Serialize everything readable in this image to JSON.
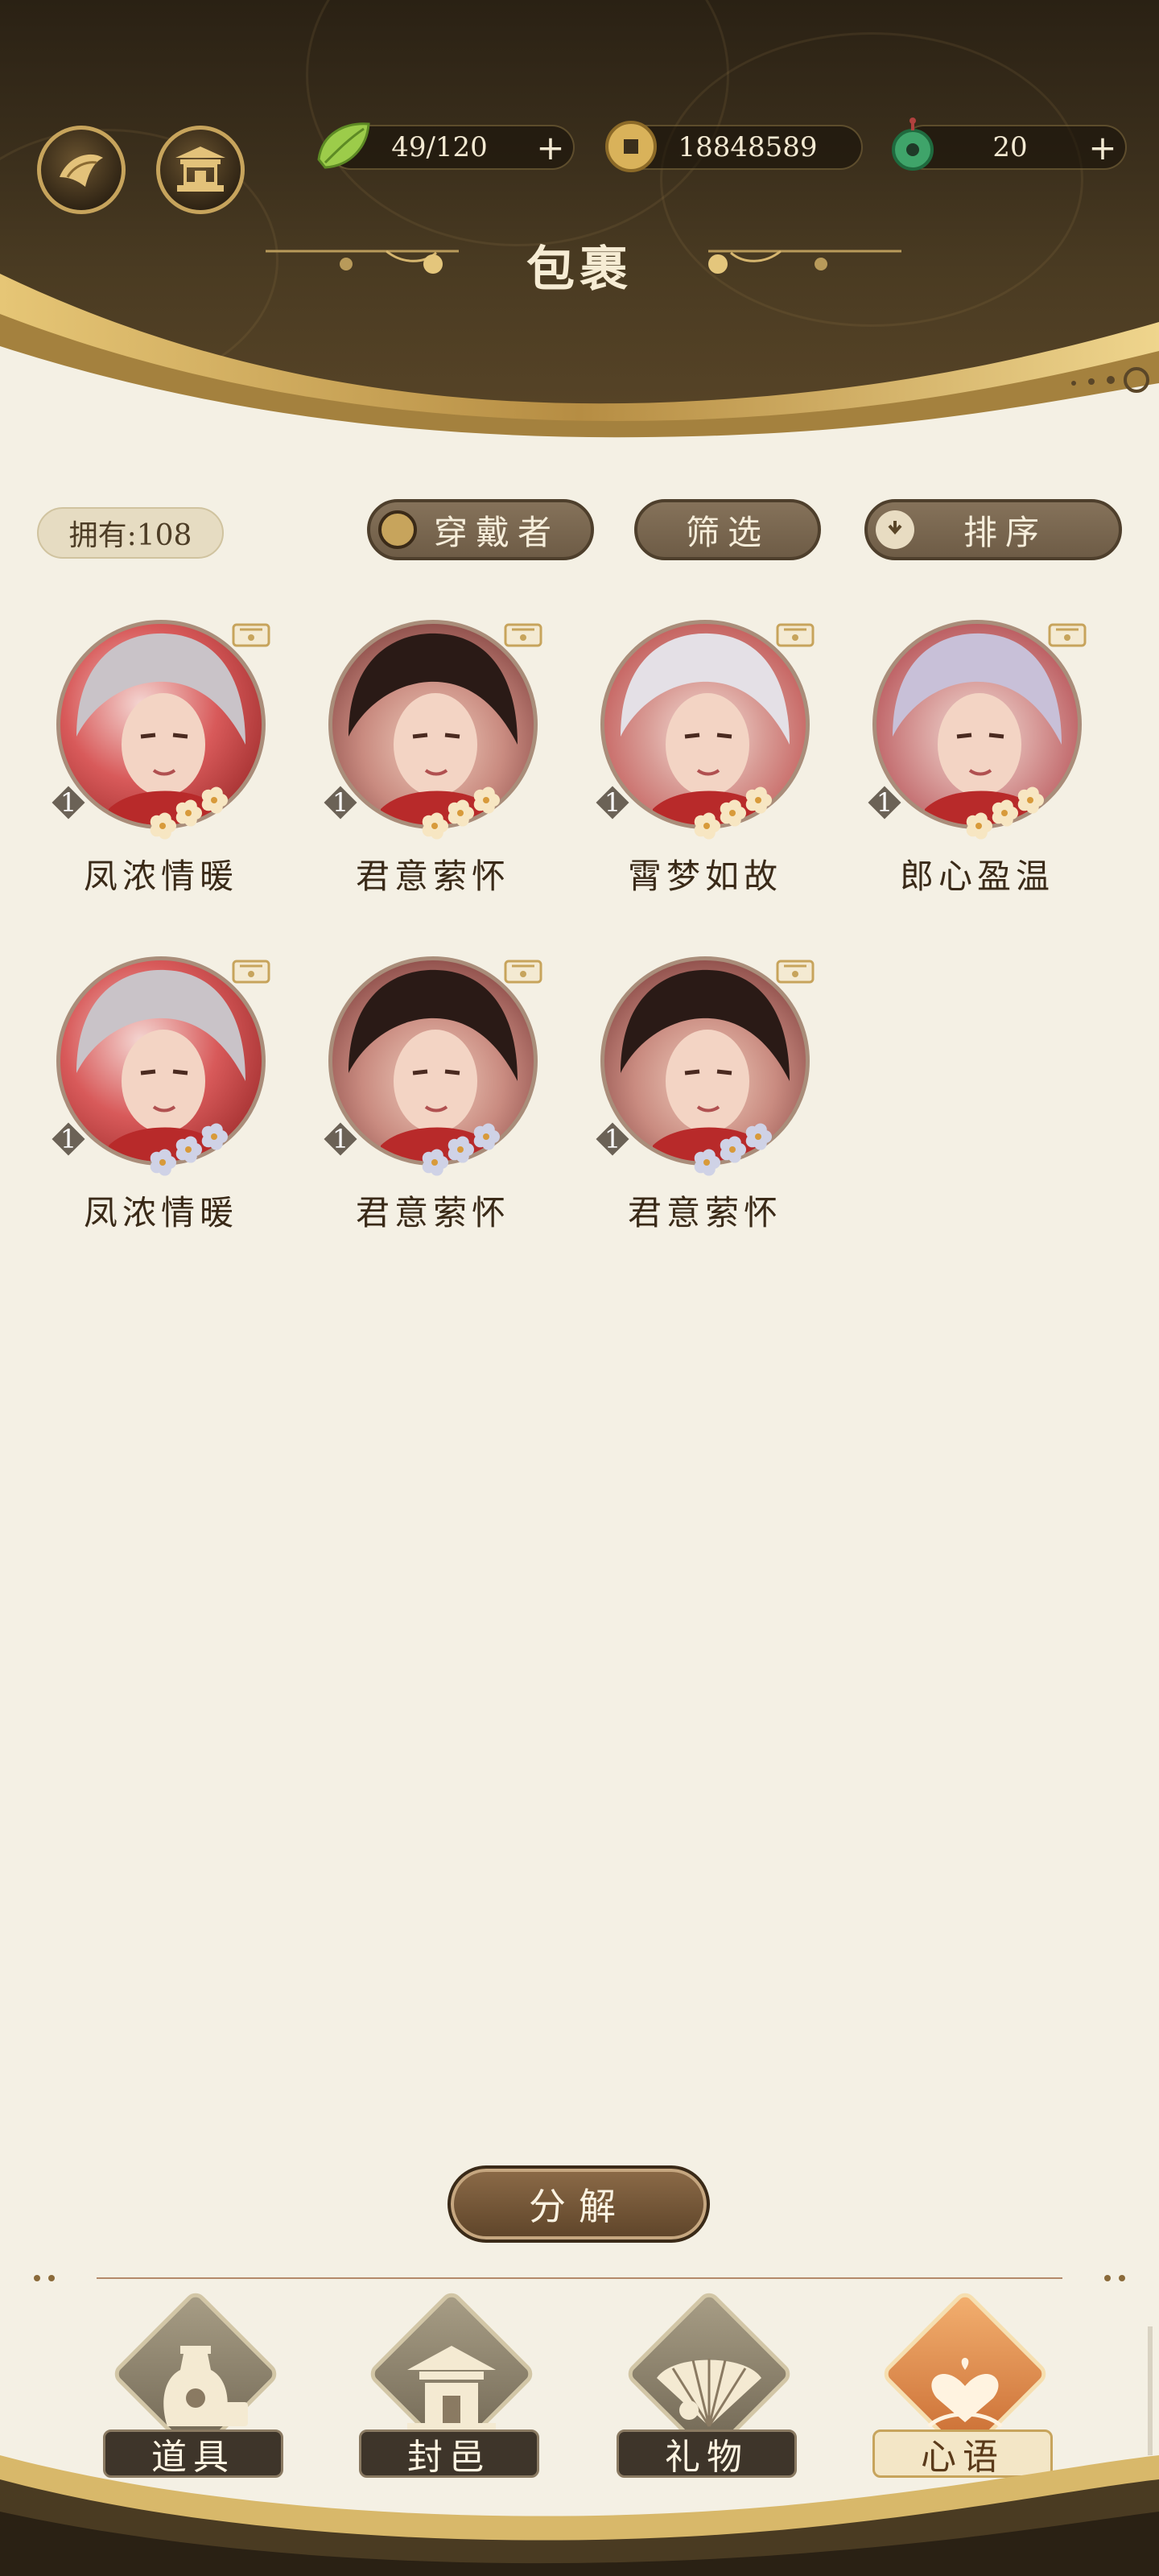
{
  "header": {
    "title": "包裹",
    "left_buttons": [
      {
        "name": "fan-icon"
      },
      {
        "name": "pavilion-icon"
      }
    ],
    "resources": {
      "stamina": {
        "value": "49/120",
        "icon": "leaf-icon"
      },
      "coins": {
        "value": "18848589",
        "icon": "coin-icon"
      },
      "jade": {
        "value": "20",
        "icon": "jade-pendant-icon"
      }
    },
    "plus": "+"
  },
  "toolbar": {
    "owned": "拥有:108",
    "wearer": "穿戴者",
    "filter": "筛选",
    "sort": "排序"
  },
  "items": [
    {
      "name": "凤浓情暖",
      "count": "1",
      "portrait": "red-veil-portrait"
    },
    {
      "name": "君意萦怀",
      "count": "1",
      "portrait": "dark-hair-portrait"
    },
    {
      "name": "霄梦如故",
      "count": "1",
      "portrait": "silver-hair-portrait"
    },
    {
      "name": "郎心盈温",
      "count": "1",
      "portrait": "lavender-hair-portrait"
    },
    {
      "name": "凤浓情暖",
      "count": "1",
      "portrait": "red-veil-portrait"
    },
    {
      "name": "君意萦怀",
      "count": "1",
      "portrait": "dark-hair-portrait"
    },
    {
      "name": "君意萦怀",
      "count": "1",
      "portrait": "dark-hair-portrait"
    }
  ],
  "actions": {
    "decompose": "分解"
  },
  "nav": [
    {
      "label": "道具",
      "icon": "vase-icon",
      "active": false
    },
    {
      "label": "封邑",
      "icon": "palace-icon",
      "active": false
    },
    {
      "label": "礼物",
      "icon": "folding-fan-icon",
      "active": false
    },
    {
      "label": "心语",
      "icon": "heart-bloom-icon",
      "active": true
    }
  ],
  "colors": {
    "header_dark": "#2a2114",
    "gold": "#c7a45c",
    "paper": "#f4f0e4",
    "button_brown": "#6e5c46",
    "active_orange": "#d8874a"
  }
}
